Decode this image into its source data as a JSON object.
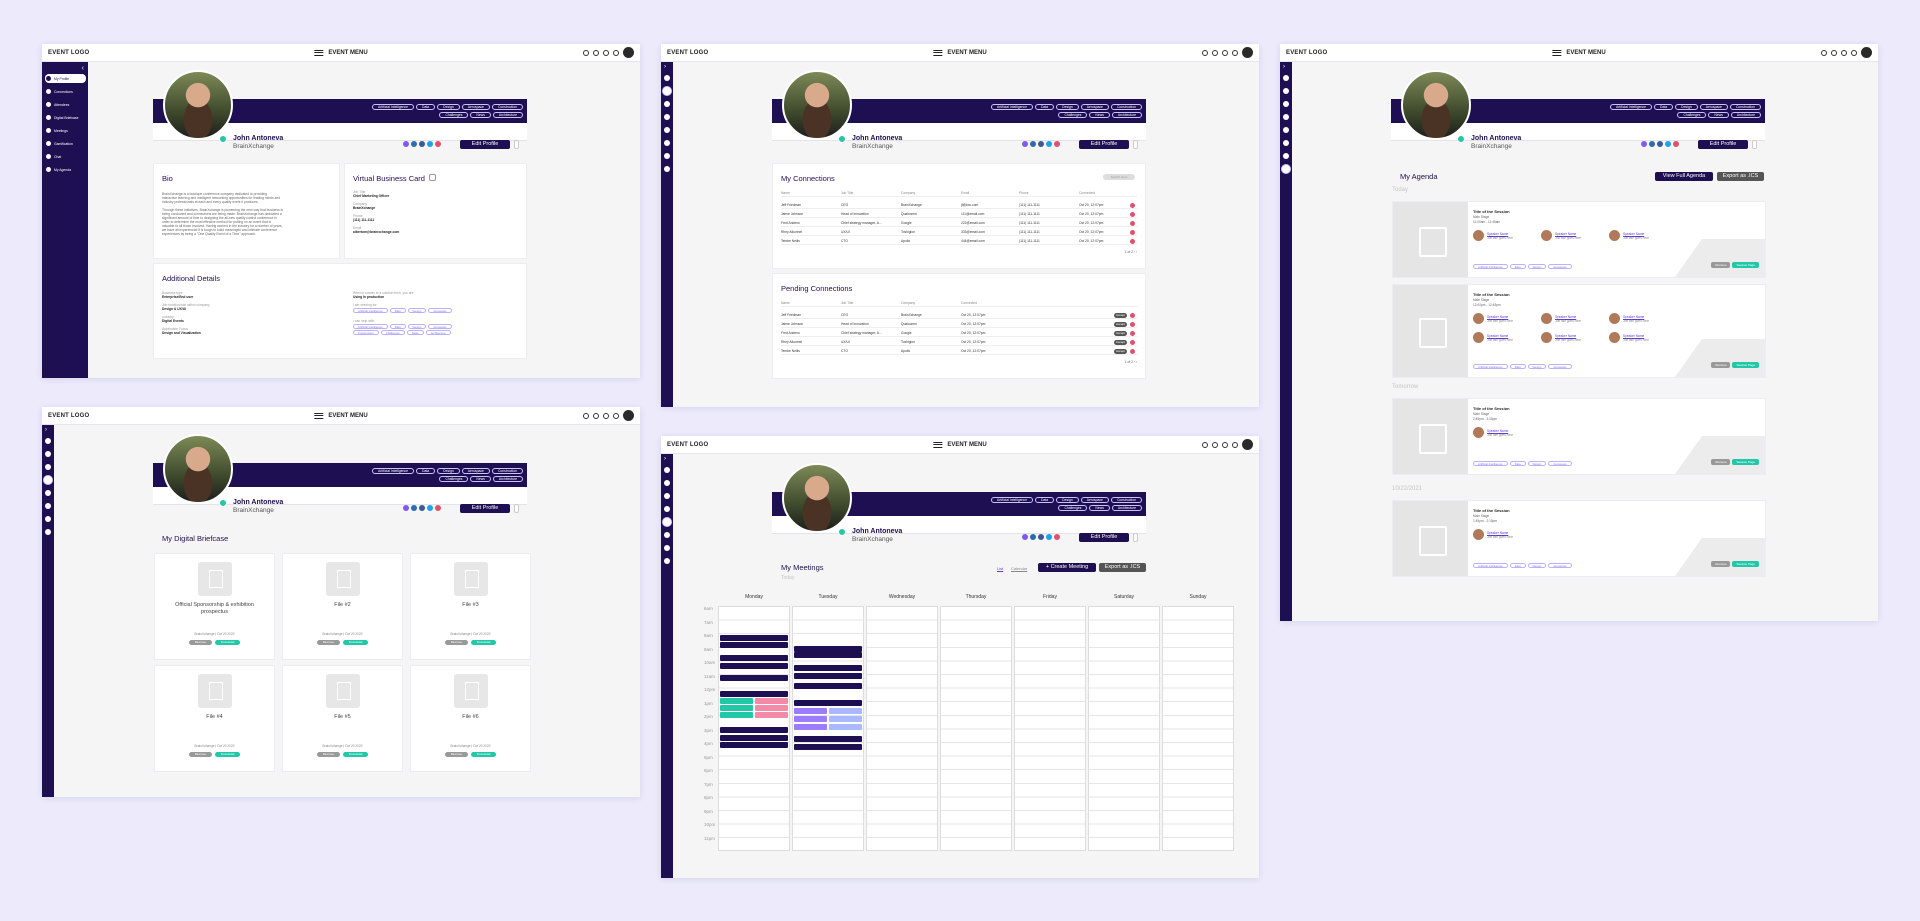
{
  "common": {
    "logo": "EVENT LOGO",
    "menu": "EVENT MENU",
    "name": "John Antoneva",
    "company": "BrainXchange",
    "edit_profile": "Edit Profile",
    "tags": [
      "Artificial Intelligence",
      "Data",
      "Design",
      "Aerospace",
      "Construction",
      "Challenges",
      "News",
      "Architecture"
    ],
    "icons": [
      "plus-circle-icon",
      "search-icon",
      "bell-icon",
      "chat-icon",
      "avatar"
    ],
    "colors": {
      "brand": "#1e0f52",
      "accent": "#22c7a8",
      "danger": "#e0516d"
    }
  },
  "sidebar_labels": [
    "My Profile",
    "Connections",
    "Attendees",
    "Digital Briefcase",
    "Meetings",
    "Gamification",
    "Chat",
    "My Agenda"
  ],
  "profile": {
    "bio_title": "Bio",
    "bio_p1": [
      "BrainXchange is a boutique conference company dedicated to providing",
      "interactive learning and intelligent networking opportunities for leading minds and",
      "industry professionals at each and every quality event it produces."
    ],
    "bio_p2": [
      "Through these initiatives, BrainXchange is pioneering the next way that business is",
      "being conducted and connections are being made. BrainXchange has dedicated a",
      "significant amount of time to designing the all-new quality control conference in",
      "order to determine the most effective method for putting on an event that is",
      "valuable to all those involved. Having worked in the industry for a number of years,",
      "we have all experienced it is tough to build meaningful and intimate conference",
      "experiences by being a \"One Quality Event of a Time\" approach."
    ],
    "vbc_title": "Virtual Business Card",
    "vbc_fields": [
      {
        "label": "Job Title",
        "value": "Chief Marketing Officer"
      },
      {
        "label": "Company",
        "value": "BrainXchange"
      },
      {
        "label": "Phone",
        "value": "(111) 111-1111"
      },
      {
        "label": "Email",
        "value": "albertom@brainxchange.com"
      }
    ],
    "additional_title": "Additional Details",
    "left_fields": [
      {
        "label": "Business type",
        "value": "Enterprise/End user"
      },
      {
        "label": "Job function/role within company",
        "value": "Design & UX/UI"
      },
      {
        "label": "Industry",
        "value": "Digital Events"
      },
      {
        "label": "Application Focus",
        "value": "Design and Visualization"
      }
    ],
    "right_fields": [
      {
        "label": "When it comes to a solution tech, you are:",
        "value": "Using in production"
      },
      {
        "label": "I am seeking for:",
        "value": ""
      },
      {
        "label": "I can help with:",
        "value": ""
      }
    ]
  },
  "connections": {
    "title": "My Connections",
    "search_label": "Search Here",
    "headers": [
      "Name",
      "Job Title",
      "Company",
      "Email",
      "Phone",
      "Connected"
    ],
    "rows": [
      [
        "Jeff Friedman",
        "CEO",
        "BrainXchange",
        "jf@bxc.com",
        "(111) 111-1111",
        "Oct 20, 12:07pm"
      ],
      [
        "Jaime Johnson",
        "Head of Innovation",
        "Qualcomm",
        "111@email.com",
        "(111) 111-1111",
        "Oct 20, 12:07pm"
      ],
      [
        "Fred Andeno",
        "Chief strategy manager, A...",
        "Google",
        "222@email.com",
        "(111) 111-1111",
        "Oct 20, 12:07pm"
      ],
      [
        "Rhey Alkonnel",
        "UX/UI",
        "Toshiglon",
        "333@email.com",
        "(111) 111-1111",
        "Oct 20, 12:07pm"
      ],
      [
        "Tembe Nellis",
        "CTO",
        "Apollo",
        "444@email.com",
        "(111) 111-1111",
        "Oct 20, 12:07pm"
      ]
    ],
    "page": "1 of 2",
    "pending_title": "Pending Connections",
    "pending_headers": [
      "Name",
      "Job Title",
      "Company",
      "Connected"
    ],
    "pending_rows": [
      [
        "Jeff Friedman",
        "CEO",
        "BrainXchange",
        "Oct 20, 12:07pm"
      ],
      [
        "Jaime Johnson",
        "Head of Innovation",
        "Qualcomm",
        "Oct 20, 12:07pm"
      ],
      [
        "Fred Andeno",
        "Chief strategy manager, A...",
        "Google",
        "Oct 20, 12:07pm"
      ],
      [
        "Rhey Alkonnel",
        "UX/UI",
        "Toshiglon",
        "Oct 20, 12:07pm"
      ],
      [
        "Tembe Nellis",
        "CTO",
        "Apollo",
        "Oct 20, 12:07pm"
      ]
    ],
    "accept_label": "Accept"
  },
  "agenda": {
    "title": "My Agenda",
    "view_full": "View Full Agenda",
    "export": "Export as .ICS",
    "sections": [
      {
        "label": "Today",
        "items": [
          {
            "title": "Title of the Session",
            "loc": "Main Stage",
            "time": "11:00am - 11:45am",
            "speakers": 3,
            "tags": [
              "Artificial Intelligence",
              "Data",
              "Design",
              "Aerospace"
            ]
          },
          {
            "title": "Title of the Session",
            "loc": "Main Stage",
            "time": "12:00pm - 12:45pm",
            "speakers": 6,
            "tags": [
              "Artificial Intelligence",
              "Data",
              "Design",
              "Aerospace"
            ]
          }
        ]
      },
      {
        "label": "Tomorrow",
        "items": [
          {
            "title": "Title of the Session",
            "loc": "Main Stage",
            "time": "2:45pm - 3:15pm",
            "speakers": 1,
            "tags": [
              "Artificial Intelligence",
              "Data",
              "Design",
              "Aerospace"
            ]
          }
        ]
      },
      {
        "label": "10/22/2021",
        "items": [
          {
            "title": "Title of the Session",
            "loc": "Main Stage",
            "time": "1:45pm - 2:15pm",
            "speakers": 1,
            "tags": [
              "Artificial Intelligence",
              "Data",
              "Design",
              "Aerospace"
            ]
          }
        ]
      }
    ],
    "speaker_name": "Speaker Name",
    "speaker_sub": "Job title goes here",
    "remove": "Remove",
    "session_page": "Session Page"
  },
  "briefcase": {
    "title": "My Digital Briefcase",
    "files": [
      {
        "title": "Official Sponsorship & exhibition prospectus",
        "meta": "BrainXchange | Oct 20 2020"
      },
      {
        "title": "File #2",
        "meta": "BrainXchange | Oct 20 2020"
      },
      {
        "title": "File #3",
        "meta": "BrainXchange | Oct 20 2020"
      },
      {
        "title": "File #4",
        "meta": "BrainXchange | Oct 20 2020"
      },
      {
        "title": "File #5",
        "meta": "BrainXchange | Oct 20 2020"
      },
      {
        "title": "File #6",
        "meta": "BrainXchange | Oct 20 2020"
      }
    ],
    "remove": "Remove",
    "download": "Download"
  },
  "meetings": {
    "title": "My Meetings",
    "today": "Today",
    "list": "List",
    "calendar": "Calendar",
    "create": "+ Create Meeting",
    "export": "Export as .ICS",
    "days": [
      "Monday",
      "Tuesday",
      "Wednesday",
      "Thursday",
      "Friday",
      "Saturday",
      "Sunday"
    ],
    "hours": [
      "6am",
      "7am",
      "8am",
      "9am",
      "10am",
      "11am",
      "12pm",
      "1pm",
      "2pm",
      "3pm",
      "4pm",
      "5pm",
      "6pm",
      "7pm",
      "8pm",
      "9pm",
      "10pm",
      "11pm"
    ]
  }
}
